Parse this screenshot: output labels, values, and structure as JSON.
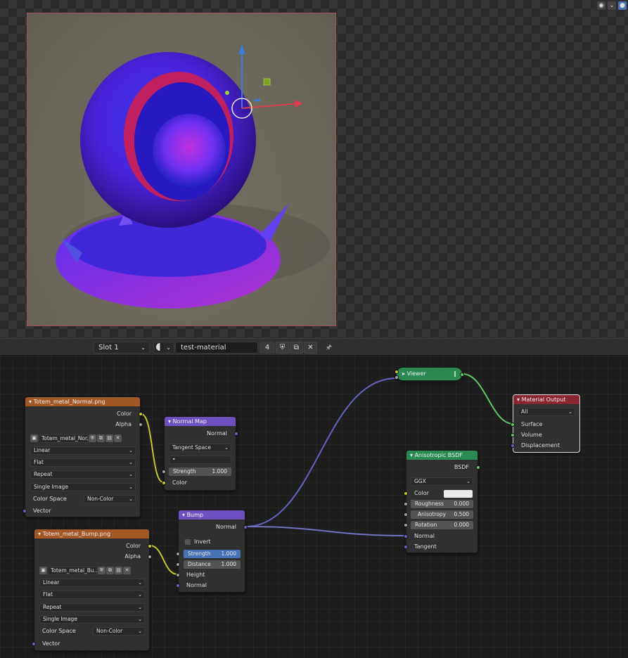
{
  "header": {
    "slot": "Slot 1",
    "material_name": "test-material",
    "user_count": "4"
  },
  "nodes": {
    "normal_image": {
      "title": "Totem_metal_Normal.png",
      "out_color": "Color",
      "out_alpha": "Alpha",
      "image_name": "Totem_metal_Nor...",
      "interpolation": "Linear",
      "projection": "Flat",
      "extension": "Repeat",
      "source": "Single Image",
      "color_space_label": "Color Space",
      "color_space": "Non-Color",
      "in_vector": "Vector"
    },
    "normal_map": {
      "title": "Normal Map",
      "out_normal": "Normal",
      "space": "Tangent Space",
      "uv": "•",
      "strength_label": "Strength",
      "strength": "1.000",
      "in_color": "Color"
    },
    "bump_image": {
      "title": "Totem_metal_Bump.png",
      "out_color": "Color",
      "out_alpha": "Alpha",
      "image_name": "Totem_metal_Bu...",
      "interpolation": "Linear",
      "projection": "Flat",
      "extension": "Repeat",
      "source": "Single Image",
      "color_space_label": "Color Space",
      "color_space": "Non-Color",
      "in_vector": "Vector"
    },
    "bump": {
      "title": "Bump",
      "out_normal": "Normal",
      "invert": "Invert",
      "strength_label": "Strength",
      "strength": "1.000",
      "distance_label": "Distance",
      "distance": "1.000",
      "in_height": "Height",
      "in_normal": "Normal"
    },
    "viewer": {
      "title": "Viewer"
    },
    "anisotropic": {
      "title": "Anisotropic BSDF",
      "out_bsdf": "BSDF",
      "distribution": "GGX",
      "color_label": "Color",
      "roughness_label": "Roughness",
      "roughness": "0.000",
      "anisotropy_label": "Anisotropy",
      "anisotropy": "0.500",
      "rotation_label": "Rotation",
      "rotation": "0.000",
      "in_normal": "Normal",
      "in_tangent": "Tangent"
    },
    "output": {
      "title": "Material Output",
      "target": "All",
      "in_surface": "Surface",
      "in_volume": "Volume",
      "in_displacement": "Displacement"
    }
  },
  "colors": {
    "texture_header": "#a25726",
    "vector_header": "#6e51c0",
    "shader_header": "#2b8a53",
    "output_header": "#8a2632",
    "socket_color": "#c7c729",
    "socket_float": "#a1a1a1",
    "socket_vector": "#6363c7",
    "socket_shader": "#63c763"
  }
}
